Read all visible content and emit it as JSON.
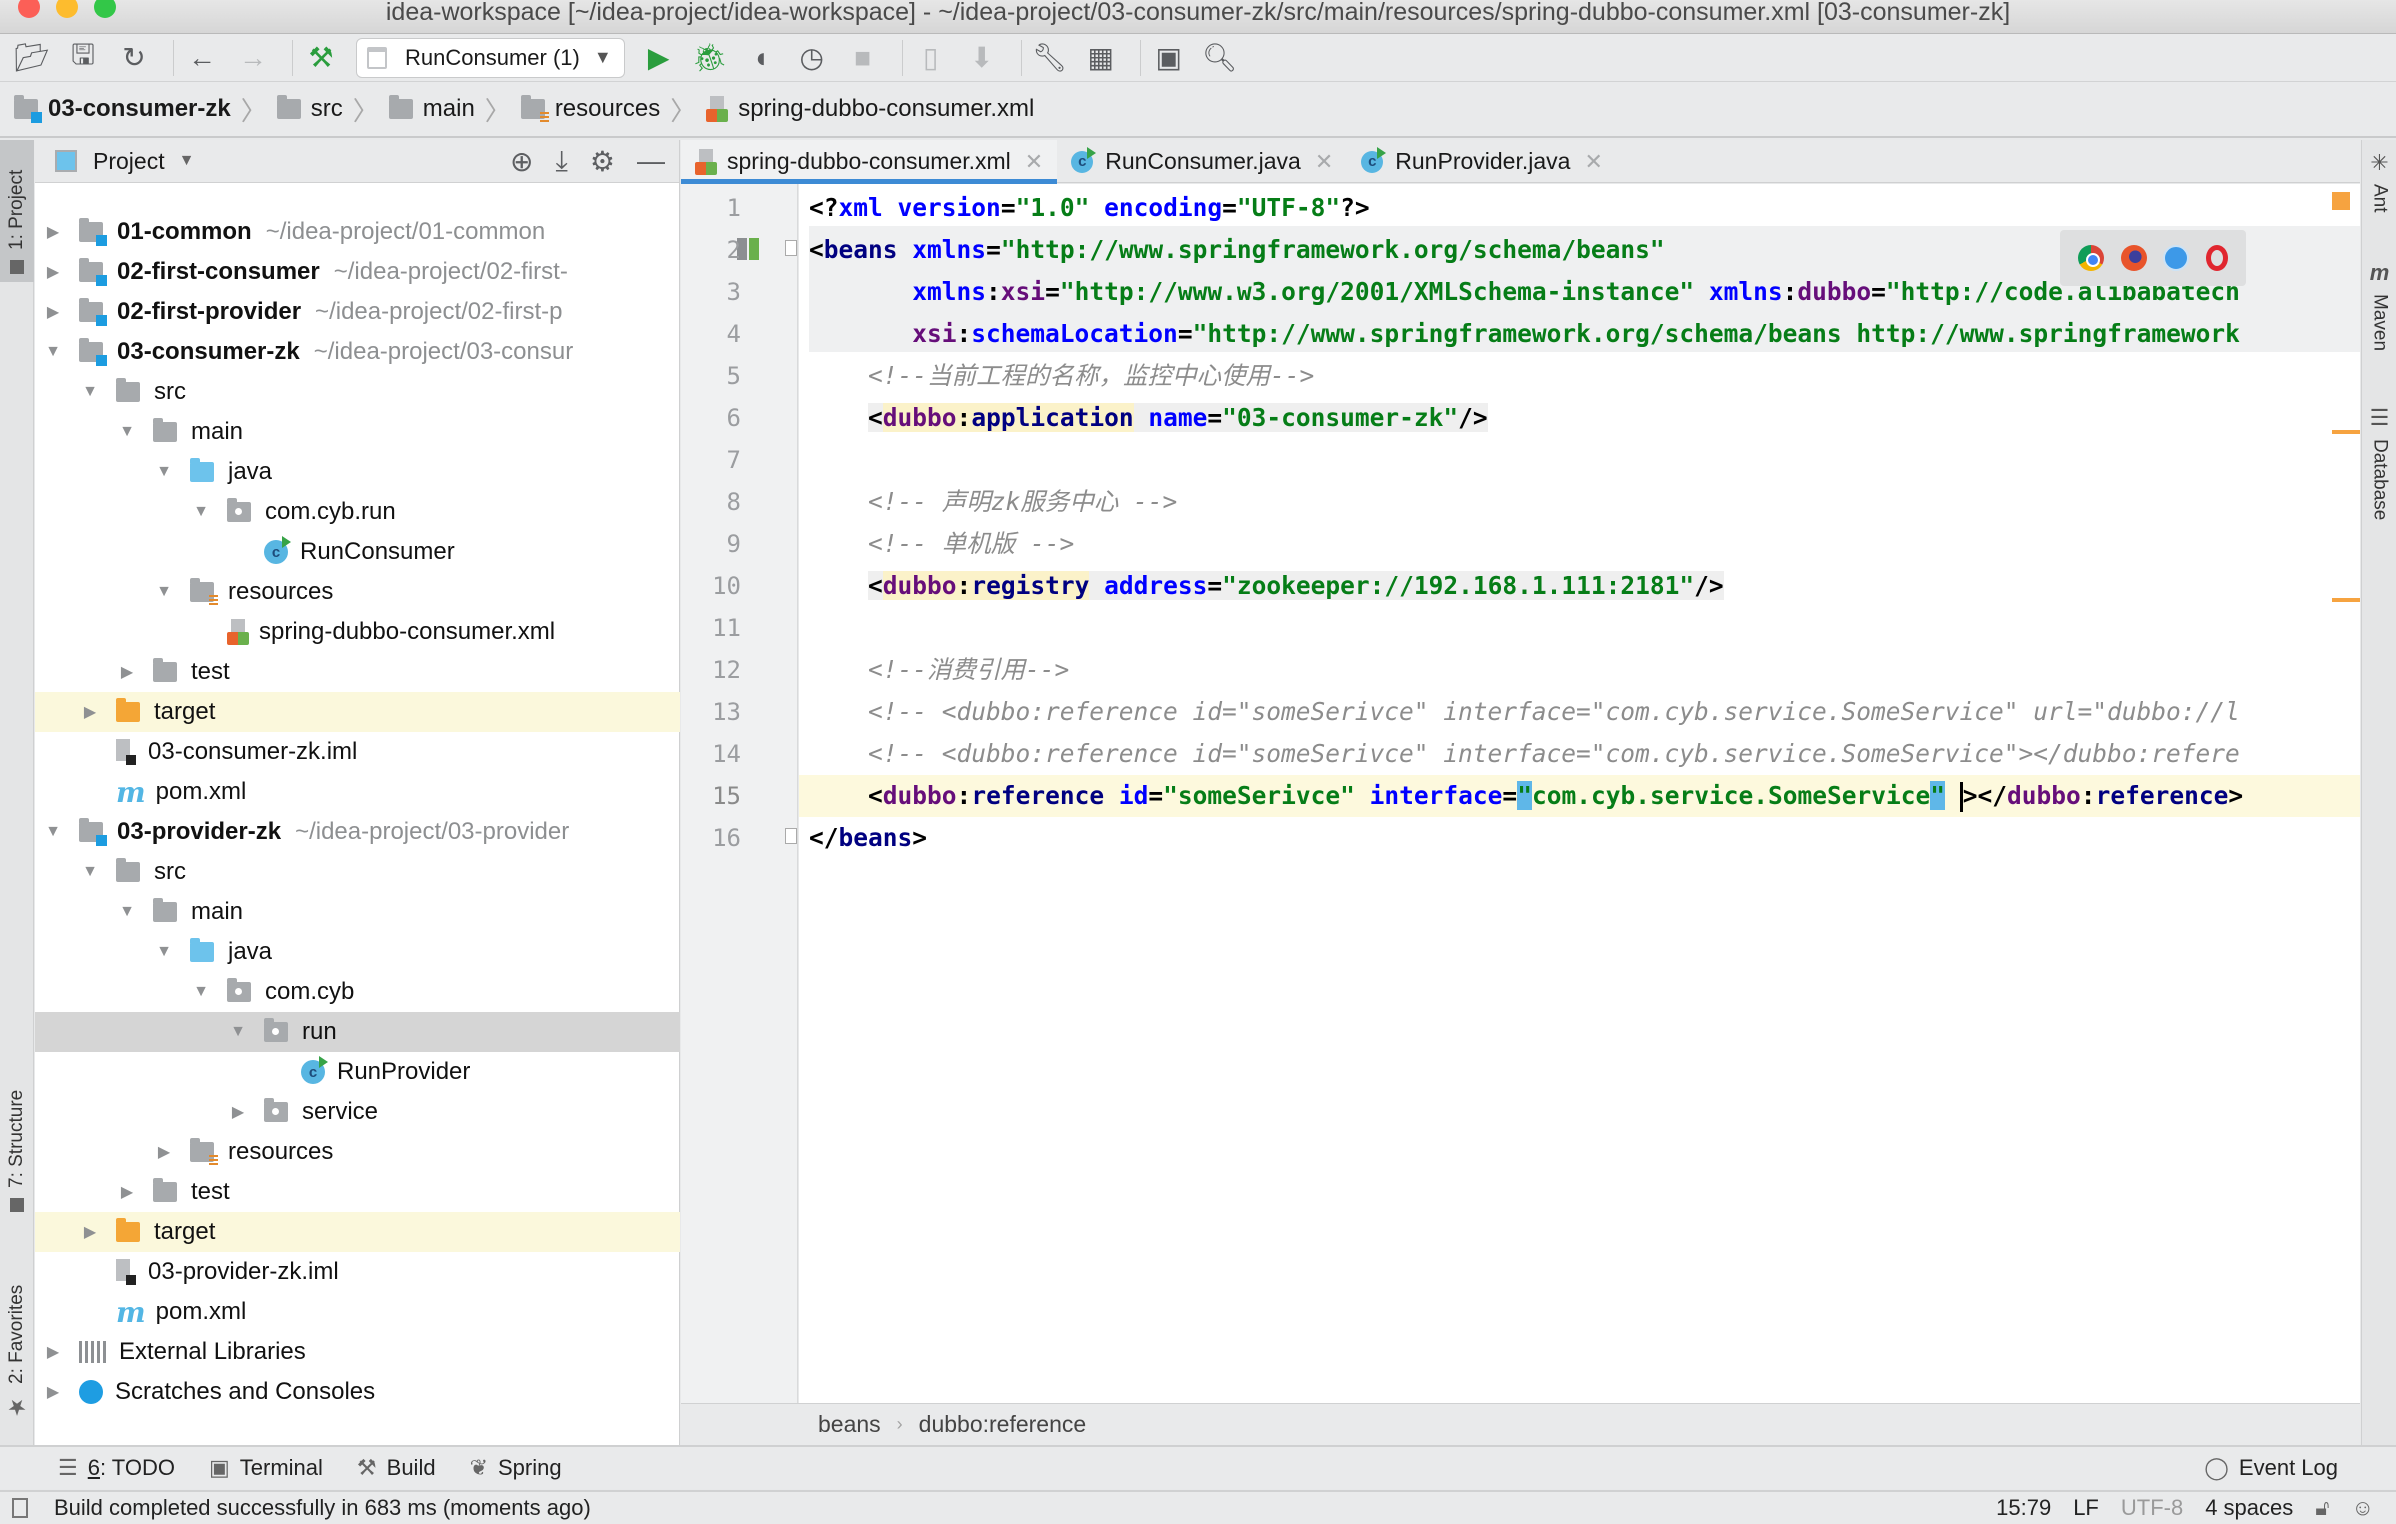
{
  "window": {
    "title": "idea-workspace [~/idea-project/idea-workspace] - ~/idea-project/03-consumer-zk/src/main/resources/spring-dubbo-consumer.xml [03-consumer-zk]"
  },
  "toolbar": {
    "run_config": "RunConsumer (1)",
    "icons": [
      "open-folder-icon",
      "save-icon",
      "sync-icon",
      "back-arrow-icon",
      "forward-arrow-icon",
      "build-hammer-icon",
      "run-icon",
      "debug-icon",
      "coverage-icon",
      "profile-icon",
      "stop-icon",
      "android-device-icon",
      "sdk-download-icon",
      "settings-wrench-icon",
      "project-structure-icon",
      "run-anything-icon",
      "search-icon"
    ]
  },
  "navbar": {
    "crumbs": [
      "03-consumer-zk",
      "src",
      "main",
      "resources",
      "spring-dubbo-consumer.xml"
    ]
  },
  "left_stripe": {
    "project": "1: Project",
    "structure": "7: Structure",
    "favorites": "2: Favorites"
  },
  "project_panel": {
    "view": "Project",
    "tree": [
      {
        "name": "01-common",
        "path": "~/idea-project/01-common",
        "type": "module",
        "expanded": false,
        "depth": 0
      },
      {
        "name": "02-first-consumer",
        "path": "~/idea-project/02-first-",
        "type": "module",
        "expanded": false,
        "depth": 0
      },
      {
        "name": "02-first-provider",
        "path": "~/idea-project/02-first-p",
        "type": "module",
        "expanded": false,
        "depth": 0
      },
      {
        "name": "03-consumer-zk",
        "path": "~/idea-project/03-consur",
        "type": "module",
        "expanded": true,
        "depth": 0
      },
      {
        "name": "src",
        "type": "folder",
        "expanded": true,
        "depth": 1
      },
      {
        "name": "main",
        "type": "folder",
        "expanded": true,
        "depth": 2
      },
      {
        "name": "java",
        "type": "source-folder",
        "expanded": true,
        "depth": 3
      },
      {
        "name": "com.cyb.run",
        "type": "package",
        "expanded": true,
        "depth": 4
      },
      {
        "name": "RunConsumer",
        "type": "class",
        "depth": 5
      },
      {
        "name": "resources",
        "type": "resources",
        "expanded": true,
        "depth": 3
      },
      {
        "name": "spring-dubbo-consumer.xml",
        "type": "xml",
        "depth": 4
      },
      {
        "name": "test",
        "type": "folder",
        "expanded": false,
        "depth": 2
      },
      {
        "name": "target",
        "type": "excluded",
        "expanded": false,
        "depth": 1
      },
      {
        "name": "03-consumer-zk.iml",
        "type": "iml",
        "depth": 1
      },
      {
        "name": "pom.xml",
        "type": "pom",
        "depth": 1
      },
      {
        "name": "03-provider-zk",
        "path": "~/idea-project/03-provider",
        "type": "module",
        "expanded": true,
        "depth": 0
      },
      {
        "name": "src",
        "type": "folder",
        "expanded": true,
        "depth": 1
      },
      {
        "name": "main",
        "type": "folder",
        "expanded": true,
        "depth": 2
      },
      {
        "name": "java",
        "type": "source-folder",
        "expanded": true,
        "depth": 3
      },
      {
        "name": "com.cyb",
        "type": "package",
        "expanded": true,
        "depth": 4
      },
      {
        "name": "run",
        "type": "package",
        "expanded": true,
        "depth": 5,
        "selected": true
      },
      {
        "name": "RunProvider",
        "type": "class",
        "depth": 6
      },
      {
        "name": "service",
        "type": "package",
        "expanded": false,
        "depth": 5
      },
      {
        "name": "resources",
        "type": "resources",
        "expanded": false,
        "depth": 3
      },
      {
        "name": "test",
        "type": "folder",
        "expanded": false,
        "depth": 2
      },
      {
        "name": "target",
        "type": "excluded",
        "expanded": false,
        "depth": 1
      },
      {
        "name": "03-provider-zk.iml",
        "type": "iml",
        "depth": 1
      },
      {
        "name": "pom.xml",
        "type": "pom",
        "depth": 1
      },
      {
        "name": "External Libraries",
        "type": "libraries",
        "expanded": false,
        "depth": 0
      },
      {
        "name": "Scratches and Consoles",
        "type": "scratches",
        "expanded": false,
        "depth": 0
      }
    ]
  },
  "editor": {
    "tabs": [
      {
        "label": "spring-dubbo-consumer.xml",
        "type": "xml",
        "active": true
      },
      {
        "label": "RunConsumer.java",
        "type": "class",
        "active": false
      },
      {
        "label": "RunProvider.java",
        "type": "class",
        "active": false
      }
    ],
    "current_line": 15,
    "lines": [
      [
        [
          "p",
          "<?"
        ],
        [
          "a",
          "xml"
        ],
        [
          "p",
          " "
        ],
        [
          "a",
          "version"
        ],
        [
          "p",
          "="
        ],
        [
          "v",
          "\"1.0\""
        ],
        [
          "p",
          " "
        ],
        [
          "a",
          "encoding"
        ],
        [
          "p",
          "="
        ],
        [
          "v",
          "\"UTF-8\""
        ],
        [
          "p",
          "?>"
        ]
      ],
      [
        [
          "p",
          "<"
        ],
        [
          "t",
          "beans"
        ],
        [
          "p",
          " "
        ],
        [
          "a",
          "xmlns"
        ],
        [
          "p",
          "="
        ],
        [
          "v",
          "\"http://www.springframework.org/schema/beans\""
        ]
      ],
      [
        [
          "p",
          "       "
        ],
        [
          "a",
          "xmlns"
        ],
        [
          "p",
          ":"
        ],
        [
          "n",
          "xsi"
        ],
        [
          "p",
          "="
        ],
        [
          "v",
          "\"http://www.w3.org/2001/XMLSchema-instance\""
        ],
        [
          "p",
          " "
        ],
        [
          "a",
          "xmlns"
        ],
        [
          "p",
          ":"
        ],
        [
          "n",
          "dubbo"
        ],
        [
          "p",
          "="
        ],
        [
          "v",
          "\"http://code.alibabatech"
        ]
      ],
      [
        [
          "p",
          "       "
        ],
        [
          "n",
          "xsi"
        ],
        [
          "p",
          ":"
        ],
        [
          "a",
          "schemaLocation"
        ],
        [
          "p",
          "="
        ],
        [
          "v",
          "\"http://www.springframework.org/schema/beans http://www.springframework"
        ]
      ],
      [
        [
          "p",
          "    "
        ],
        [
          "c",
          "<!--当前工程的名称，监控中心使用-->"
        ]
      ],
      [
        [
          "p",
          "    "
        ],
        [
          "p",
          "<"
        ],
        [
          "hn",
          "dubbo"
        ],
        [
          "hp",
          ":"
        ],
        [
          "ht",
          "application"
        ],
        [
          "p",
          " "
        ],
        [
          "a",
          "name"
        ],
        [
          "p",
          "="
        ],
        [
          "v",
          "\"03-consumer-zk\""
        ],
        [
          "p",
          "/>"
        ]
      ],
      [],
      [
        [
          "p",
          "    "
        ],
        [
          "c",
          "<!-- 声明zk服务中心 -->"
        ]
      ],
      [
        [
          "p",
          "    "
        ],
        [
          "c",
          "<!-- 单机版 -->"
        ]
      ],
      [
        [
          "p",
          "    "
        ],
        [
          "p",
          "<"
        ],
        [
          "hn",
          "dubbo"
        ],
        [
          "hp",
          ":"
        ],
        [
          "ht",
          "registry"
        ],
        [
          "p",
          " "
        ],
        [
          "a",
          "address"
        ],
        [
          "p",
          "="
        ],
        [
          "v",
          "\"zookeeper://192.168.1.111:2181\""
        ],
        [
          "p",
          "/>"
        ]
      ],
      [],
      [
        [
          "p",
          "    "
        ],
        [
          "c",
          "<!--消费引用-->"
        ]
      ],
      [
        [
          "p",
          "    "
        ],
        [
          "c",
          "<!-- <dubbo:reference id=\"someSerivce\" interface=\"com.cyb.service.SomeService\" url=\"dubbo://l"
        ]
      ],
      [
        [
          "p",
          "    "
        ],
        [
          "c",
          "<!-- <dubbo:reference id=\"someSerivce\" interface=\"com.cyb.service.SomeService\"></dubbo:refere"
        ]
      ],
      [
        [
          "p",
          "    "
        ],
        [
          "p",
          "<"
        ],
        [
          "n",
          "dubbo"
        ],
        [
          "p",
          ":"
        ],
        [
          "t",
          "reference"
        ],
        [
          "p",
          " "
        ],
        [
          "a",
          "id"
        ],
        [
          "p",
          "="
        ],
        [
          "v",
          "\"someSerivce\""
        ],
        [
          "p",
          " "
        ],
        [
          "a",
          "interface"
        ],
        [
          "p",
          "="
        ],
        [
          "k",
          "\""
        ],
        [
          "v",
          "com.cyb.service.SomeService"
        ],
        [
          "k",
          "\""
        ],
        [
          "p",
          " "
        ],
        [
          "cur",
          ""
        ],
        [
          "p",
          ">"
        ],
        [
          "p",
          "</"
        ],
        [
          "n",
          "dubbo"
        ],
        [
          "p",
          ":"
        ],
        [
          "t",
          "reference"
        ],
        [
          "p",
          ">"
        ]
      ],
      [
        [
          "p",
          "</"
        ],
        [
          "t",
          "beans"
        ],
        [
          "p",
          ">"
        ]
      ]
    ],
    "browser_popup": [
      "chrome-icon",
      "firefox-icon",
      "safari-icon",
      "opera-icon"
    ],
    "breadcrumb": [
      "beans",
      "dubbo:reference"
    ]
  },
  "right_stripe": {
    "ant": "Ant",
    "maven": "Maven",
    "database": "Database"
  },
  "bottom_tools": {
    "todo_num": "6",
    "todo": ": TODO",
    "terminal": "Terminal",
    "build": "Build",
    "spring": "Spring",
    "event_log": "Event Log"
  },
  "status": {
    "message": "Build completed successfully in 683 ms (moments ago)",
    "position": "15:79",
    "line_sep": "LF",
    "encoding": "UTF-8",
    "indent": "4 spaces"
  }
}
